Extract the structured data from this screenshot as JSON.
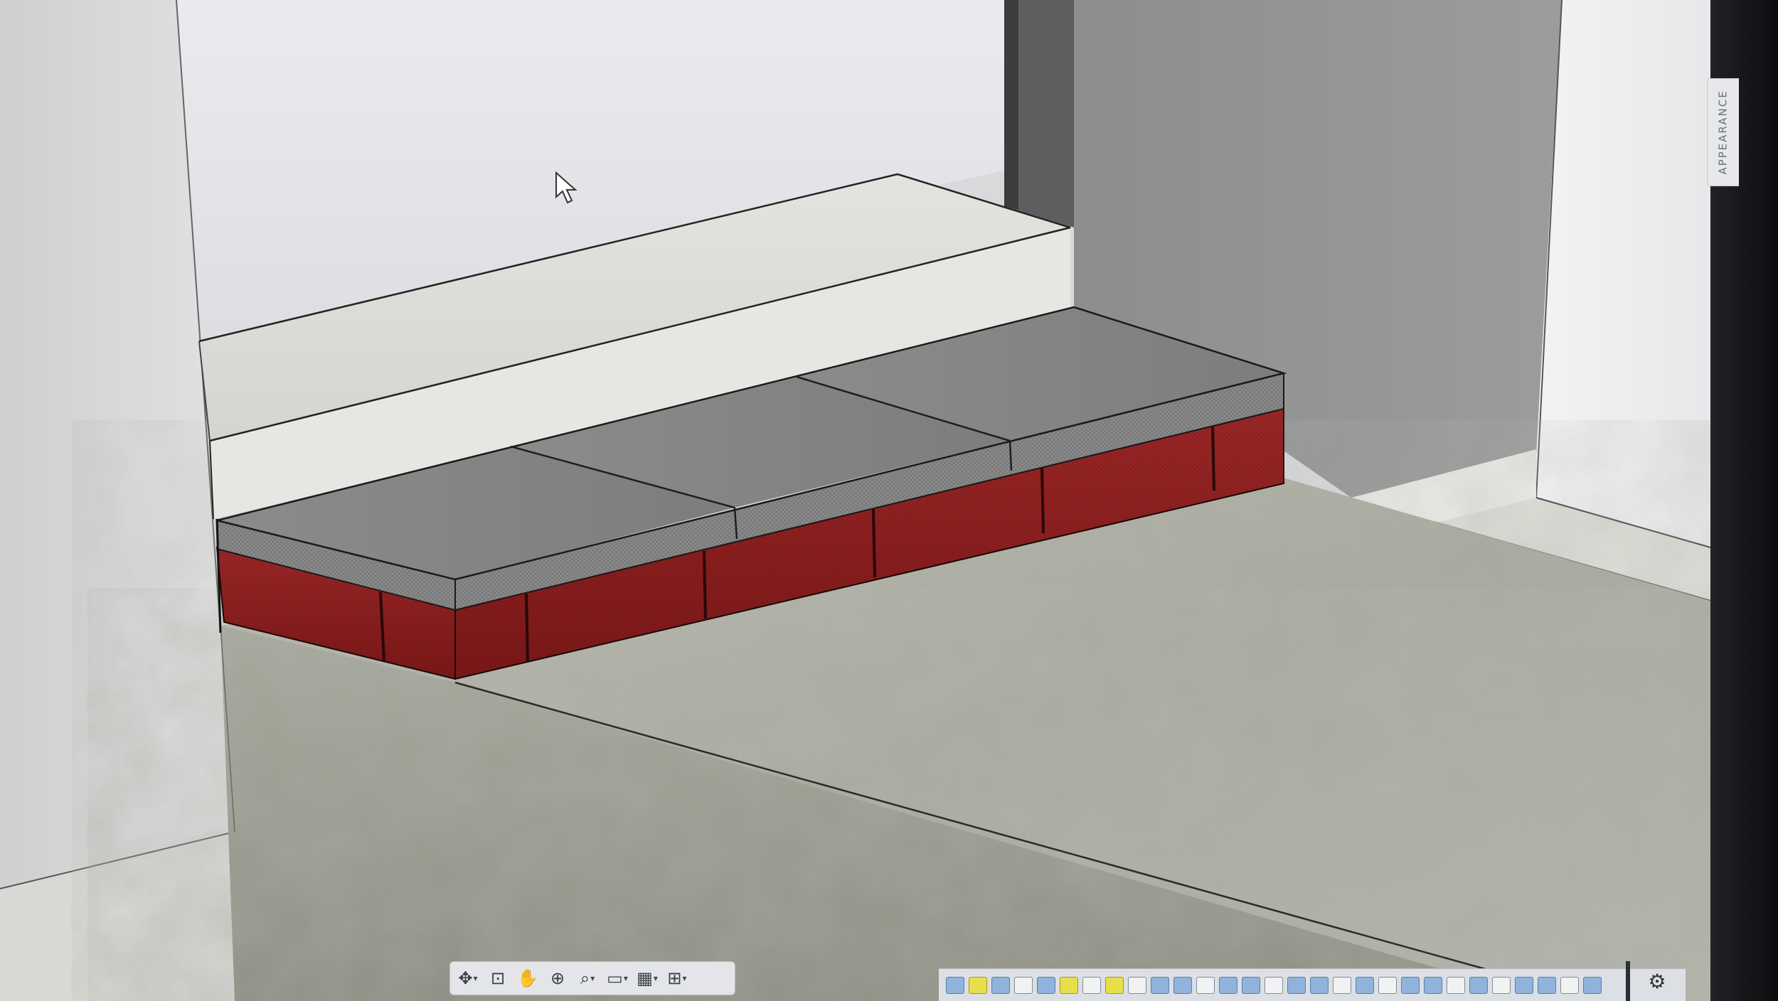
{
  "panel": {
    "appearance_label": "APPEARANCE"
  },
  "icons": {
    "orbit": "orbit-icon",
    "look_at": "look-at-icon",
    "pan": "pan-icon",
    "zoom": "zoom-icon",
    "fit": "fit-icon",
    "display_settings": "display-settings-icon",
    "grid": "grid-icon",
    "viewports": "viewports-icon",
    "settings": "gear-icon"
  },
  "colors": {
    "brick": "#8e1f1f",
    "pavers": "#858585",
    "concrete": "#a7a89e",
    "walls": "#e4e4e4"
  }
}
